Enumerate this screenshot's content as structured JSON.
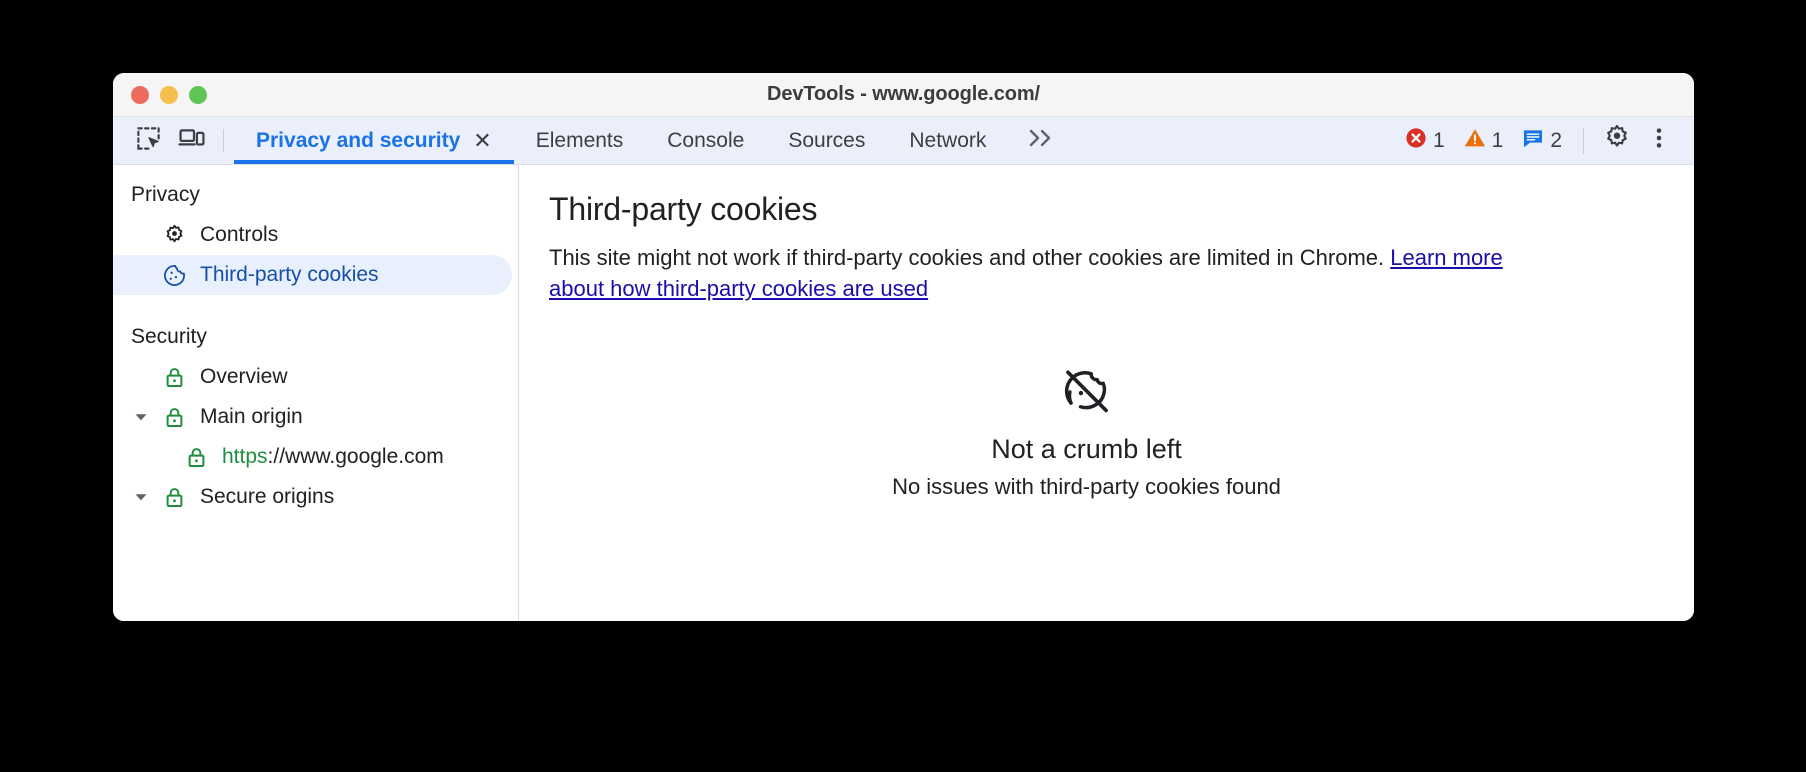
{
  "window": {
    "title": "DevTools - www.google.com/",
    "traffic_lights": [
      {
        "name": "close",
        "color": "#ec6a5e"
      },
      {
        "name": "minimize",
        "color": "#f4bf4f"
      },
      {
        "name": "maximize",
        "color": "#61c555"
      }
    ]
  },
  "toolbar": {
    "inspect_icon": "inspect-element-icon",
    "device_icon": "device-toolbar-icon",
    "tabs": [
      {
        "label": "Privacy and security",
        "active": true,
        "closable": true
      },
      {
        "label": "Elements",
        "active": false,
        "closable": false
      },
      {
        "label": "Console",
        "active": false,
        "closable": false
      },
      {
        "label": "Sources",
        "active": false,
        "closable": false
      },
      {
        "label": "Network",
        "active": false,
        "closable": false
      }
    ],
    "close_glyph": "✕",
    "overflow_label": "»",
    "counters": [
      {
        "name": "errors",
        "icon": "error-icon",
        "count": "1",
        "color": "#d93025"
      },
      {
        "name": "warnings",
        "icon": "warning-icon",
        "count": "1",
        "color": "#e8710a"
      },
      {
        "name": "messages",
        "icon": "message-icon",
        "count": "2",
        "color": "#1a73e8"
      }
    ],
    "settings_icon": "gear-icon",
    "more_icon": "kebab-menu-icon"
  },
  "sidebar": {
    "sections": [
      {
        "title": "Privacy",
        "items": [
          {
            "label": "Controls",
            "icon": "gear-icon",
            "indent": 1,
            "selected": false,
            "twisty": null
          },
          {
            "label": "Third-party cookies",
            "icon": "cookie-icon",
            "indent": 1,
            "selected": true,
            "twisty": null
          }
        ]
      },
      {
        "title": "Security",
        "items": [
          {
            "label": "Overview",
            "icon": "lock-icon",
            "indent": 1,
            "selected": false,
            "twisty": null
          },
          {
            "label": "Main origin",
            "icon": "lock-icon",
            "indent": 1,
            "selected": false,
            "twisty": "expanded"
          },
          {
            "label": "https://www.google.com",
            "label_scheme": "https",
            "label_rest": "://www.google.com",
            "icon": "lock-icon",
            "indent": 2,
            "selected": false,
            "twisty": null
          },
          {
            "label": "Secure origins",
            "icon": "lock-icon",
            "indent": 1,
            "selected": false,
            "twisty": "expanded"
          }
        ]
      }
    ]
  },
  "main": {
    "heading": "Third-party cookies",
    "description_before": "This site might not work if third-party cookies and other cookies are limited in Chrome. ",
    "link_text": "Learn more about how third-party cookies are used",
    "empty_state": {
      "icon": "cookie-off-icon",
      "title": "Not a crumb left",
      "subtitle": "No issues with third-party cookies found"
    }
  },
  "colors": {
    "accent_blue": "#1a73e8",
    "selected_bg": "#e8f0fe",
    "selected_text": "#174ea6",
    "toolbar_bg": "#eaeffb",
    "link": "#1a0dab",
    "lock_green": "#1e8e3e",
    "error_red": "#d93025",
    "warning_orange": "#e8710a"
  }
}
